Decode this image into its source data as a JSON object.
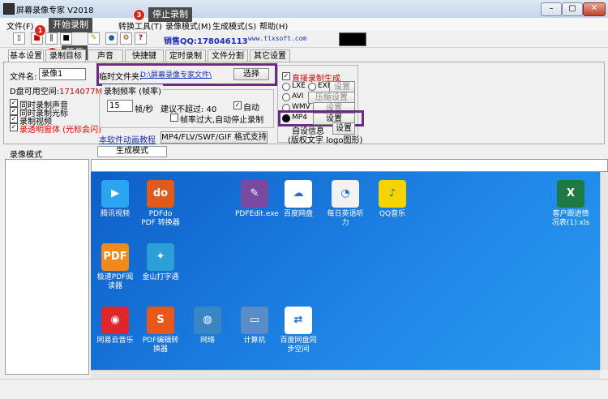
{
  "window": {
    "title": "屏幕录像专家 V2018",
    "minimize": "–",
    "maximize": "▢",
    "close": "✕"
  },
  "menu": [
    "文件(F)",
    "转换工具(T)",
    "录像模式(M)",
    "生成模式(S)",
    "帮助(H)"
  ],
  "toolbar": {
    "sales_qq": "销售QQ:178046113",
    "website": "www.tlxsoft.com"
  },
  "callouts": [
    {
      "num": "1",
      "label": "开始录制"
    },
    {
      "num": "2",
      "label": "暂停"
    },
    {
      "num": "3",
      "label": "停止录制"
    }
  ],
  "tabs": [
    "基本设置",
    "录制目标",
    "声音",
    "快捷键",
    "定时录制",
    "文件分割",
    "其它设置"
  ],
  "basic": {
    "filename_label": "文件名:",
    "filename_value": "录像1",
    "disk_label": "D盘可用空间:",
    "disk_value": "1714077M",
    "options": [
      "同时录制声音",
      "同时录制光标",
      "录制视频",
      "录透明窗体 (光标会闪)"
    ],
    "temp_folder_label": "临时文件夹:",
    "temp_folder_value": "D:\\屏幕录像专家文件\\",
    "choose_button": "选择",
    "frame_group_label": "录制频率 (帧率)",
    "fps_value": "15",
    "fps_unit": "帧/秒",
    "fps_hint": "建议不超过: 40",
    "auto_label": "自动",
    "auto_stop_label": "帧率过大,自动停止录制",
    "tutorial_link": "本软件动画教程",
    "formats_button": "MP4/FLV/SWF/GIF 格式支持"
  },
  "generate": {
    "direct_label": "直接录制生成",
    "formats": [
      {
        "name": "LXE",
        "selected": false
      },
      {
        "name": "EXE",
        "selected": false
      },
      {
        "name": "AVI",
        "selected": false
      },
      {
        "name": "WMV",
        "selected": false
      },
      {
        "name": "MP4",
        "selected": true
      }
    ],
    "settings_button": "设置",
    "compress_button": "压缩设置",
    "custom_info": "自设信息",
    "custom_sub": "(版权文字 logo图形)"
  },
  "left_panel": {
    "title": "录像模式"
  },
  "right_panel": {
    "tab": "生成模式"
  },
  "desktop_icons": [
    {
      "label": "腾讯视频",
      "icon": "tencent-video-icon",
      "color": "#2aa5f0",
      "glyph": "▶"
    },
    {
      "label": "PDFdo PDF 转换器",
      "icon": "pdfdo-icon",
      "color": "#e05a1c",
      "glyph": "do"
    },
    {
      "label": "PDFEdit.exe",
      "icon": "pdfedit-icon",
      "color": "#7a4aa0",
      "glyph": "✎"
    },
    {
      "label": "百度网盘",
      "icon": "baidu-netdisk-icon",
      "color": "#ffffff",
      "glyph": "☁"
    },
    {
      "label": "每日英语听力",
      "icon": "english-listening-icon",
      "color": "#f2f2f2",
      "glyph": "◔"
    },
    {
      "label": "QQ音乐",
      "icon": "qq-music-icon",
      "color": "#f5d400",
      "glyph": "♪"
    },
    {
      "label": "客户跟进情况表(1).xls",
      "icon": "excel-file-icon",
      "color": "#1d7a44",
      "glyph": "X"
    },
    {
      "label": "极速PDF阅读器",
      "icon": "fast-pdf-reader-icon",
      "color": "#f08a1c",
      "glyph": "PDF"
    },
    {
      "label": "金山打字通",
      "icon": "kingsoft-typing-icon",
      "color": "#2a9fd8",
      "glyph": "✦"
    },
    {
      "label": "网易云音乐",
      "icon": "netease-music-icon",
      "color": "#e0262b",
      "glyph": "◉"
    },
    {
      "label": "PDF编辑转换器",
      "icon": "pdf-editor-converter-icon",
      "color": "#e9581b",
      "glyph": "S"
    },
    {
      "label": "网络",
      "icon": "network-icon",
      "color": "#3a86c4",
      "glyph": "◍"
    },
    {
      "label": "计算机",
      "icon": "computer-icon",
      "color": "#5a8cc8",
      "glyph": "▭"
    },
    {
      "label": "百度网盘同步空间",
      "icon": "baidu-sync-icon",
      "color": "#ffffff",
      "glyph": "⇄"
    }
  ]
}
